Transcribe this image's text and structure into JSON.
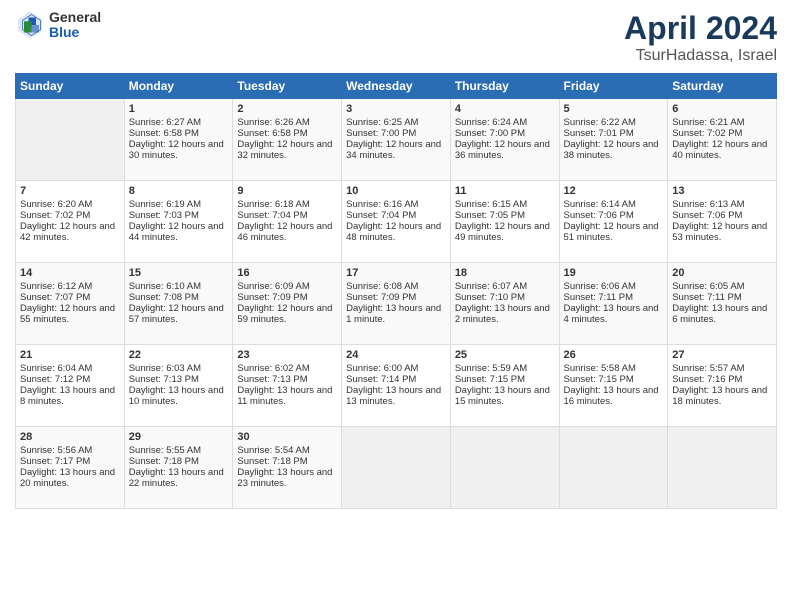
{
  "header": {
    "logo_general": "General",
    "logo_blue": "Blue",
    "month_title": "April 2024",
    "location": "TsurHadassa, Israel"
  },
  "days_of_week": [
    "Sunday",
    "Monday",
    "Tuesday",
    "Wednesday",
    "Thursday",
    "Friday",
    "Saturday"
  ],
  "weeks": [
    [
      {
        "day": "",
        "empty": true
      },
      {
        "day": "1",
        "sunrise": "Sunrise: 6:27 AM",
        "sunset": "Sunset: 6:58 PM",
        "daylight": "Daylight: 12 hours and 30 minutes."
      },
      {
        "day": "2",
        "sunrise": "Sunrise: 6:26 AM",
        "sunset": "Sunset: 6:58 PM",
        "daylight": "Daylight: 12 hours and 32 minutes."
      },
      {
        "day": "3",
        "sunrise": "Sunrise: 6:25 AM",
        "sunset": "Sunset: 7:00 PM",
        "daylight": "Daylight: 12 hours and 34 minutes."
      },
      {
        "day": "4",
        "sunrise": "Sunrise: 6:24 AM",
        "sunset": "Sunset: 7:00 PM",
        "daylight": "Daylight: 12 hours and 36 minutes."
      },
      {
        "day": "5",
        "sunrise": "Sunrise: 6:22 AM",
        "sunset": "Sunset: 7:01 PM",
        "daylight": "Daylight: 12 hours and 38 minutes."
      },
      {
        "day": "6",
        "sunrise": "Sunrise: 6:21 AM",
        "sunset": "Sunset: 7:02 PM",
        "daylight": "Daylight: 12 hours and 40 minutes."
      }
    ],
    [
      {
        "day": "7",
        "sunrise": "Sunrise: 6:20 AM",
        "sunset": "Sunset: 7:02 PM",
        "daylight": "Daylight: 12 hours and 42 minutes."
      },
      {
        "day": "8",
        "sunrise": "Sunrise: 6:19 AM",
        "sunset": "Sunset: 7:03 PM",
        "daylight": "Daylight: 12 hours and 44 minutes."
      },
      {
        "day": "9",
        "sunrise": "Sunrise: 6:18 AM",
        "sunset": "Sunset: 7:04 PM",
        "daylight": "Daylight: 12 hours and 46 minutes."
      },
      {
        "day": "10",
        "sunrise": "Sunrise: 6:16 AM",
        "sunset": "Sunset: 7:04 PM",
        "daylight": "Daylight: 12 hours and 48 minutes."
      },
      {
        "day": "11",
        "sunrise": "Sunrise: 6:15 AM",
        "sunset": "Sunset: 7:05 PM",
        "daylight": "Daylight: 12 hours and 49 minutes."
      },
      {
        "day": "12",
        "sunrise": "Sunrise: 6:14 AM",
        "sunset": "Sunset: 7:06 PM",
        "daylight": "Daylight: 12 hours and 51 minutes."
      },
      {
        "day": "13",
        "sunrise": "Sunrise: 6:13 AM",
        "sunset": "Sunset: 7:06 PM",
        "daylight": "Daylight: 12 hours and 53 minutes."
      }
    ],
    [
      {
        "day": "14",
        "sunrise": "Sunrise: 6:12 AM",
        "sunset": "Sunset: 7:07 PM",
        "daylight": "Daylight: 12 hours and 55 minutes."
      },
      {
        "day": "15",
        "sunrise": "Sunrise: 6:10 AM",
        "sunset": "Sunset: 7:08 PM",
        "daylight": "Daylight: 12 hours and 57 minutes."
      },
      {
        "day": "16",
        "sunrise": "Sunrise: 6:09 AM",
        "sunset": "Sunset: 7:09 PM",
        "daylight": "Daylight: 12 hours and 59 minutes."
      },
      {
        "day": "17",
        "sunrise": "Sunrise: 6:08 AM",
        "sunset": "Sunset: 7:09 PM",
        "daylight": "Daylight: 13 hours and 1 minute."
      },
      {
        "day": "18",
        "sunrise": "Sunrise: 6:07 AM",
        "sunset": "Sunset: 7:10 PM",
        "daylight": "Daylight: 13 hours and 2 minutes."
      },
      {
        "day": "19",
        "sunrise": "Sunrise: 6:06 AM",
        "sunset": "Sunset: 7:11 PM",
        "daylight": "Daylight: 13 hours and 4 minutes."
      },
      {
        "day": "20",
        "sunrise": "Sunrise: 6:05 AM",
        "sunset": "Sunset: 7:11 PM",
        "daylight": "Daylight: 13 hours and 6 minutes."
      }
    ],
    [
      {
        "day": "21",
        "sunrise": "Sunrise: 6:04 AM",
        "sunset": "Sunset: 7:12 PM",
        "daylight": "Daylight: 13 hours and 8 minutes."
      },
      {
        "day": "22",
        "sunrise": "Sunrise: 6:03 AM",
        "sunset": "Sunset: 7:13 PM",
        "daylight": "Daylight: 13 hours and 10 minutes."
      },
      {
        "day": "23",
        "sunrise": "Sunrise: 6:02 AM",
        "sunset": "Sunset: 7:13 PM",
        "daylight": "Daylight: 13 hours and 11 minutes."
      },
      {
        "day": "24",
        "sunrise": "Sunrise: 6:00 AM",
        "sunset": "Sunset: 7:14 PM",
        "daylight": "Daylight: 13 hours and 13 minutes."
      },
      {
        "day": "25",
        "sunrise": "Sunrise: 5:59 AM",
        "sunset": "Sunset: 7:15 PM",
        "daylight": "Daylight: 13 hours and 15 minutes."
      },
      {
        "day": "26",
        "sunrise": "Sunrise: 5:58 AM",
        "sunset": "Sunset: 7:15 PM",
        "daylight": "Daylight: 13 hours and 16 minutes."
      },
      {
        "day": "27",
        "sunrise": "Sunrise: 5:57 AM",
        "sunset": "Sunset: 7:16 PM",
        "daylight": "Daylight: 13 hours and 18 minutes."
      }
    ],
    [
      {
        "day": "28",
        "sunrise": "Sunrise: 5:56 AM",
        "sunset": "Sunset: 7:17 PM",
        "daylight": "Daylight: 13 hours and 20 minutes."
      },
      {
        "day": "29",
        "sunrise": "Sunrise: 5:55 AM",
        "sunset": "Sunset: 7:18 PM",
        "daylight": "Daylight: 13 hours and 22 minutes."
      },
      {
        "day": "30",
        "sunrise": "Sunrise: 5:54 AM",
        "sunset": "Sunset: 7:18 PM",
        "daylight": "Daylight: 13 hours and 23 minutes."
      },
      {
        "day": "",
        "empty": true
      },
      {
        "day": "",
        "empty": true
      },
      {
        "day": "",
        "empty": true
      },
      {
        "day": "",
        "empty": true
      }
    ]
  ]
}
